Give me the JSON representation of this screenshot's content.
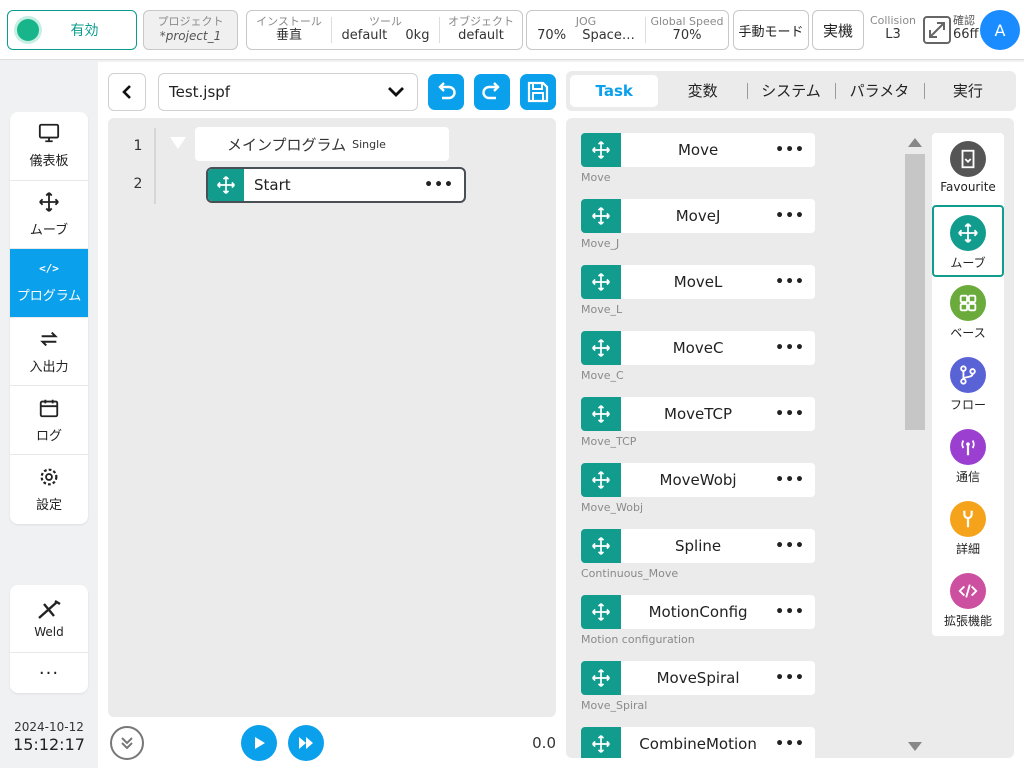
{
  "topbar": {
    "enable_label": "有効",
    "project_label": "プロジェクト",
    "project_value": "*project_1",
    "install_label": "インストール",
    "install_value": "垂直",
    "tool_label": "ツール",
    "tool_name": "default",
    "tool_weight": "0kg",
    "object_label": "オブジェクト",
    "object_value": "default",
    "jog_label": "JOG",
    "jog_percent": "70%",
    "jog_space": "Space…",
    "global_speed_label": "Global Speed",
    "global_speed_value": "70%",
    "manual_mode_label": "手動モード",
    "real_machine_label": "実機",
    "collision_label": "Collision",
    "collision_value": "L3",
    "confirm_label": "確認",
    "confirm_value": "66ff",
    "avatar_letter": "A",
    "colors": {
      "accent": "#0aa0ec",
      "teal": "#129c8e",
      "enable_dot": "#18b58a"
    }
  },
  "leftnav": {
    "items": [
      {
        "label": "儀表板",
        "icon": "monitor-icon",
        "active": false
      },
      {
        "label": "ムーブ",
        "icon": "move-icon",
        "active": false
      },
      {
        "label": "プログラム",
        "icon": "code-icon",
        "glyph": "</>",
        "active": true
      },
      {
        "label": "入出力",
        "icon": "io-arrows-icon",
        "active": false
      },
      {
        "label": "ログ",
        "icon": "calendar-icon",
        "active": false
      },
      {
        "label": "設定",
        "icon": "gear-icon",
        "active": false
      }
    ],
    "weld_label": "Weld",
    "more_label": "···"
  },
  "datetime": {
    "date": "2024-10-12",
    "time": "15:12:17"
  },
  "program": {
    "filename": "Test.jspf",
    "lines": [
      {
        "number": "1",
        "label": "メインプログラム",
        "tag": "Single"
      },
      {
        "number": "2",
        "label": "Start"
      }
    ],
    "dots": "•••",
    "speed_value": "0.0"
  },
  "tabs": [
    {
      "label": "Task",
      "active": true
    },
    {
      "label": "変数",
      "active": false
    },
    {
      "label": "システム",
      "active": false
    },
    {
      "label": "パラメタ",
      "active": false
    },
    {
      "label": "実行",
      "active": false
    }
  ],
  "commands": [
    {
      "label": "Move",
      "sub": "Move"
    },
    {
      "label": "MoveJ",
      "sub": "Move_J"
    },
    {
      "label": "MoveL",
      "sub": "Move_L"
    },
    {
      "label": "MoveC",
      "sub": "Move_C"
    },
    {
      "label": "MoveTCP",
      "sub": "Move_TCP"
    },
    {
      "label": "MoveWobj",
      "sub": "Move_Wobj"
    },
    {
      "label": "Spline",
      "sub": "Continuous_Move"
    },
    {
      "label": "MotionConfig",
      "sub": "Motion configuration"
    },
    {
      "label": "MoveSpiral",
      "sub": "Move_Spiral"
    },
    {
      "label": "CombineMotion",
      "sub": ""
    }
  ],
  "categories": [
    {
      "label": "Favourite",
      "icon": "bookmark-icon",
      "color": "#555555",
      "active": false
    },
    {
      "label": "ムーブ",
      "icon": "move-icon",
      "color": "#129c8e",
      "active": true
    },
    {
      "label": "ベース",
      "icon": "grid-icon",
      "color": "#6aab3c",
      "active": false
    },
    {
      "label": "フロー",
      "icon": "branch-icon",
      "color": "#5a63d6",
      "active": false
    },
    {
      "label": "通信",
      "icon": "antenna-icon",
      "color": "#9b3fd0",
      "active": false
    },
    {
      "label": "詳細",
      "icon": "wrench-icon",
      "color": "#f5a31a",
      "active": false
    },
    {
      "label": "拡張機能",
      "icon": "code-icon",
      "color": "#cc4fa0",
      "active": false
    }
  ]
}
